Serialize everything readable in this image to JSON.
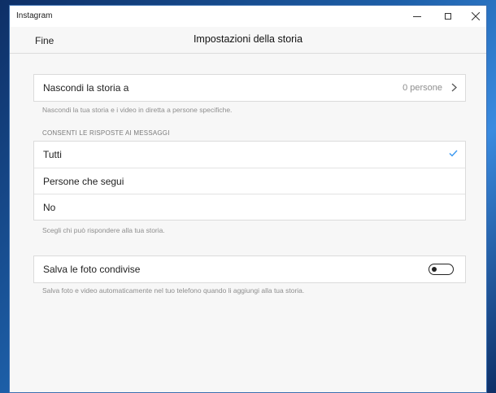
{
  "window": {
    "app_title": "Instagram"
  },
  "header": {
    "done_label": "Fine",
    "title": "Impostazioni della storia"
  },
  "hide_story": {
    "label": "Nascondi la storia a",
    "value": "0 persone",
    "hint": "Nascondi la tua storia e i video in diretta a persone specifiche."
  },
  "replies": {
    "section_title": "CONSENTI LE RISPOSTE AI MESSAGGI",
    "options": [
      {
        "label": "Tutti",
        "selected": true
      },
      {
        "label": "Persone che segui",
        "selected": false
      },
      {
        "label": "No",
        "selected": false
      }
    ],
    "hint": "Scegli chi può rispondere alla tua storia."
  },
  "save_photos": {
    "label": "Salva le foto condivise",
    "enabled": false,
    "hint": "Salva foto e video automaticamente nel tuo telefono quando li aggiungi alla tua storia."
  },
  "colors": {
    "accent": "#3897f0",
    "text": "#222222",
    "hint": "#8e8e8e"
  }
}
